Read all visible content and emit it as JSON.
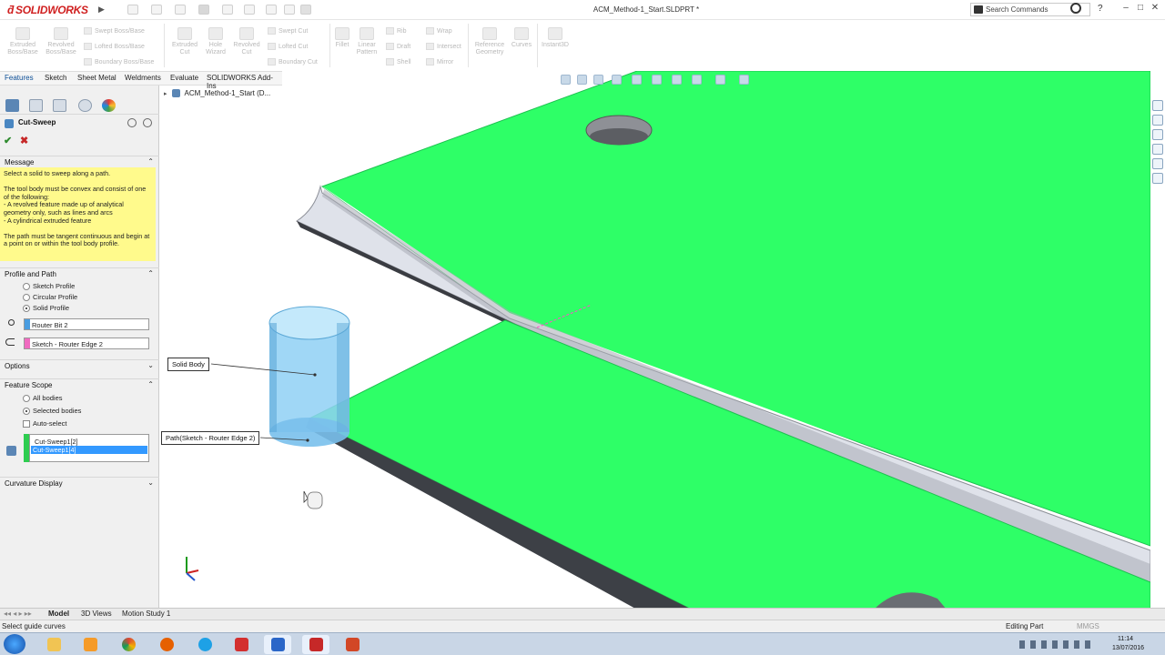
{
  "app": {
    "logo_text": "SOLIDWORKS",
    "window_title": "ACM_Method-1_Start.SLDPRT *",
    "search_placeholder": "Search Commands",
    "help_glyph": "?",
    "window_controls": [
      "–",
      "□",
      "✕"
    ]
  },
  "command_manager": {
    "large": [
      {
        "label": "Extruded\nBoss/Base",
        "icon": "extruded-boss-icon"
      },
      {
        "label": "Revolved\nBoss/Base",
        "icon": "revolved-boss-icon"
      },
      {
        "label": "Extruded\nCut",
        "icon": "extruded-cut-icon"
      },
      {
        "label": "Hole\nWizard",
        "icon": "hole-wizard-icon"
      },
      {
        "label": "Revolved\nCut",
        "icon": "revolved-cut-icon"
      },
      {
        "label": "Fillet",
        "icon": "fillet-icon"
      },
      {
        "label": "Linear\nPattern",
        "icon": "linear-pattern-icon"
      },
      {
        "label": "Reference\nGeometry",
        "icon": "reference-geometry-icon"
      },
      {
        "label": "Curves",
        "icon": "curves-icon"
      },
      {
        "label": "Instant3D",
        "icon": "instant3d-icon"
      }
    ],
    "small": [
      {
        "label": "Swept Boss/Base"
      },
      {
        "label": "Lofted Boss/Base"
      },
      {
        "label": "Boundary Boss/Base"
      },
      {
        "label": "Swept Cut"
      },
      {
        "label": "Lofted Cut"
      },
      {
        "label": "Boundary Cut"
      },
      {
        "label": "Rib"
      },
      {
        "label": "Draft"
      },
      {
        "label": "Shell"
      },
      {
        "label": "Wrap"
      },
      {
        "label": "Intersect"
      },
      {
        "label": "Mirror"
      }
    ]
  },
  "tabs": [
    "Features",
    "Sketch",
    "Sheet Metal",
    "Weldments",
    "Evaluate",
    "SOLIDWORKS Add-Ins"
  ],
  "property_manager": {
    "title": "Cut-Sweep",
    "ok_glyph": "✔",
    "cancel_glyph": "✖",
    "message_header": "Message",
    "message_text": "Select a solid to sweep along a path.\n\nThe tool body must be convex and consist of one of the following:\n   - A revolved feature made up of analytical geometry only, such as lines and arcs\n   - A cylindrical extruded feature\n\nThe path must be tangent continuous and begin at a point on or within the tool body profile.",
    "profile_path_header": "Profile and Path",
    "profile_options": [
      {
        "label": "Sketch Profile",
        "selected": false
      },
      {
        "label": "Circular Profile",
        "selected": false
      },
      {
        "label": "Solid Profile",
        "selected": true
      }
    ],
    "profile_field": "Router Bit 2",
    "path_field": "Sketch - Router Edge 2",
    "options_header": "Options",
    "feature_scope_header": "Feature Scope",
    "scope_options": [
      {
        "label": "All bodies",
        "selected": false
      },
      {
        "label": "Selected bodies",
        "selected": true
      }
    ],
    "auto_select_label": "Auto-select",
    "auto_select_checked": false,
    "selected_bodies": [
      "Cut-Sweep1[2]",
      "Cut-Sweep1[4]"
    ],
    "curvature_header": "Curvature Display"
  },
  "tree": {
    "root_label": "ACM_Method-1_Start  (D..."
  },
  "viewport": {
    "callout_solid": "Solid Body",
    "callout_path": "Path(Sketch - Router Edge 2)",
    "colors": {
      "face_green": "#2eff67",
      "edge_grey": "#9a9ea8",
      "tool_blue": "#8fd0f5"
    }
  },
  "bottom_tabs": [
    "Model",
    "3D Views",
    "Motion Study 1"
  ],
  "status": {
    "left_text": "Select guide curves",
    "editing": "Editing Part",
    "units": "MMGS"
  },
  "taskbar": {
    "time": "11:14",
    "date": "13/07/2016",
    "apps": [
      "start-orb-icon",
      "explorer-icon",
      "media-player-icon",
      "chrome-icon",
      "firefox-icon",
      "ie-icon",
      "app-red-icon",
      "network-icon",
      "solidworks-icon",
      "powerpoint-icon"
    ]
  }
}
